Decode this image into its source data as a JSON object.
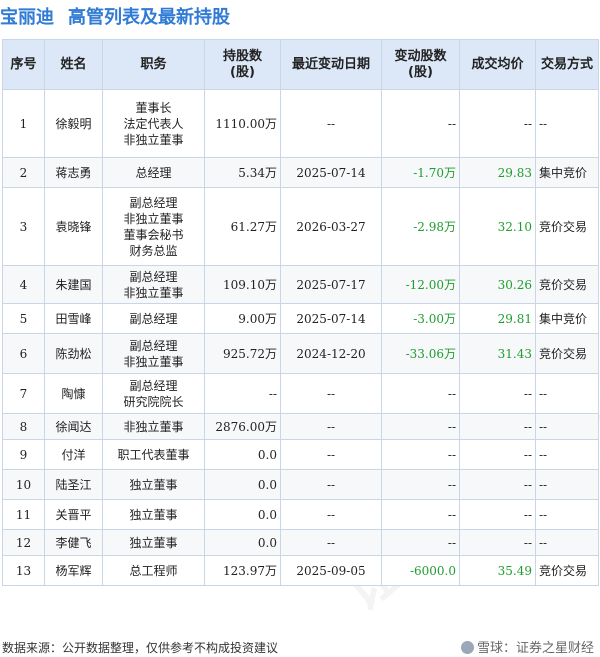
{
  "title": {
    "company": "宝丽迪",
    "heading": "高管列表及最新持股"
  },
  "columns": [
    "序号",
    "姓名",
    "职务",
    "持股数\n(股)",
    "最近变动日期",
    "变动股数\n(股)",
    "成交均价",
    "交易方式"
  ],
  "rows": [
    {
      "no": "1",
      "name": "徐毅明",
      "positions": [
        "董事长",
        "法定代表人",
        "非独立董事"
      ],
      "shares": "1110.00万",
      "date": "--",
      "change": "--",
      "price": "--",
      "method": "--"
    },
    {
      "no": "2",
      "name": "蒋志勇",
      "positions": [
        "总经理"
      ],
      "shares": "5.34万",
      "date": "2025-07-14",
      "change": "-1.70万",
      "price": "29.83",
      "method": "集中竞价"
    },
    {
      "no": "3",
      "name": "袁晓锋",
      "positions": [
        "副总经理",
        "非独立董事",
        "董事会秘书",
        "财务总监"
      ],
      "shares": "61.27万",
      "date": "2026-03-27",
      "change": "-2.98万",
      "price": "32.10",
      "method": "竞价交易"
    },
    {
      "no": "4",
      "name": "朱建国",
      "positions": [
        "副总经理",
        "非独立董事"
      ],
      "shares": "109.10万",
      "date": "2025-07-17",
      "change": "-12.00万",
      "price": "30.26",
      "method": "竞价交易"
    },
    {
      "no": "5",
      "name": "田雪峰",
      "positions": [
        "副总经理"
      ],
      "shares": "9.00万",
      "date": "2025-07-14",
      "change": "-3.00万",
      "price": "29.81",
      "method": "集中竞价"
    },
    {
      "no": "6",
      "name": "陈劲松",
      "positions": [
        "副总经理",
        "非独立董事"
      ],
      "shares": "925.72万",
      "date": "2024-12-20",
      "change": "-33.06万",
      "price": "31.43",
      "method": "竞价交易"
    },
    {
      "no": "7",
      "name": "陶慷",
      "positions": [
        "副总经理",
        "研究院院长"
      ],
      "shares": "--",
      "date": "--",
      "change": "--",
      "price": "--",
      "method": "--"
    },
    {
      "no": "8",
      "name": "徐闻达",
      "positions": [
        "非独立董事"
      ],
      "shares": "2876.00万",
      "date": "--",
      "change": "--",
      "price": "--",
      "method": "--"
    },
    {
      "no": "9",
      "name": "付洋",
      "positions": [
        "职工代表董事"
      ],
      "shares": "0.0",
      "date": "--",
      "change": "--",
      "price": "--",
      "method": "--"
    },
    {
      "no": "10",
      "name": "陆圣江",
      "positions": [
        "独立董事"
      ],
      "shares": "0.0",
      "date": "--",
      "change": "--",
      "price": "--",
      "method": "--"
    },
    {
      "no": "11",
      "name": "关晋平",
      "positions": [
        "独立董事"
      ],
      "shares": "0.0",
      "date": "--",
      "change": "--",
      "price": "--",
      "method": "--"
    },
    {
      "no": "12",
      "name": "李健飞",
      "positions": [
        "独立董事"
      ],
      "shares": "0.0",
      "date": "--",
      "change": "--",
      "price": "--",
      "method": "--"
    },
    {
      "no": "13",
      "name": "杨军辉",
      "positions": [
        "总工程师"
      ],
      "shares": "123.97万",
      "date": "2025-09-05",
      "change": "-6000.0",
      "price": "35.49",
      "method": "竞价交易"
    }
  ],
  "footer": {
    "source": "数据来源：公开数据整理，仅供参考不构成投资建议",
    "brand": "雪球：证券之星财经"
  },
  "colors": {
    "title": "#2f7bd6",
    "header_bg": "#dce8f7",
    "change_value": "#1f9d2f",
    "border": "#c9d6e6"
  },
  "icons": [
    "snowball-logo-icon"
  ]
}
